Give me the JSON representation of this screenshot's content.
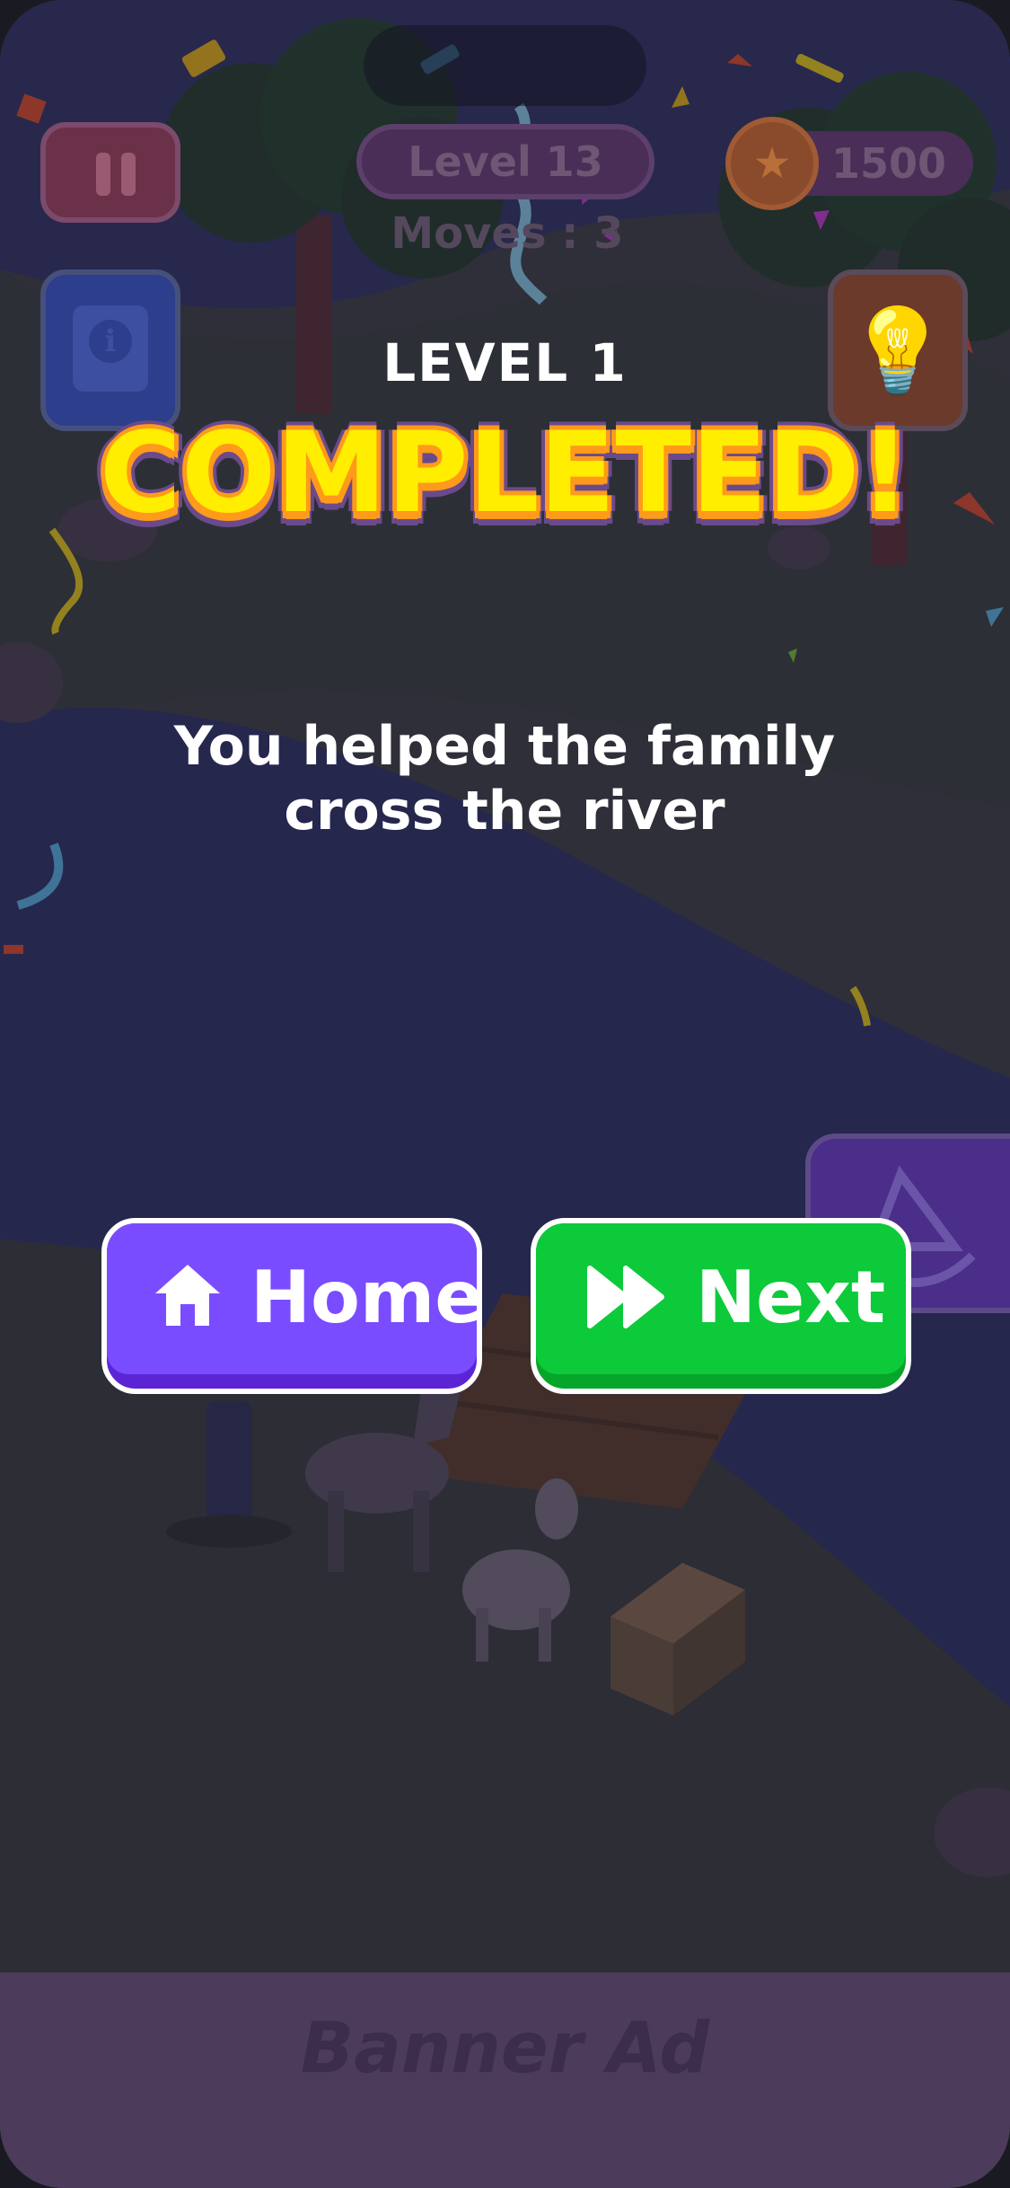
{
  "hud": {
    "level": "Level 13",
    "moves": "Moves : 3",
    "coins": "1500"
  },
  "result": {
    "level_label": "LEVEL 1",
    "title": "COMPLETED!",
    "message": "You helped the family cross the river"
  },
  "buttons": {
    "home_label": "Home",
    "next_label": "Next"
  },
  "ad": {
    "banner_label": "Banner Ad"
  },
  "colors": {
    "title_fill": "#ffee00",
    "title_outline": "#ff9a1a",
    "home_button": "#7a4cff",
    "next_button": "#0cca39",
    "banner_bg": "#4c3b5b"
  },
  "icons": {
    "pause": "pause-icon",
    "info": "info-book-icon",
    "hint": "lightbulb-icon",
    "coin": "coin-star-icon",
    "home": "home-icon",
    "next": "fast-forward-icon",
    "boat": "boat-icon"
  }
}
